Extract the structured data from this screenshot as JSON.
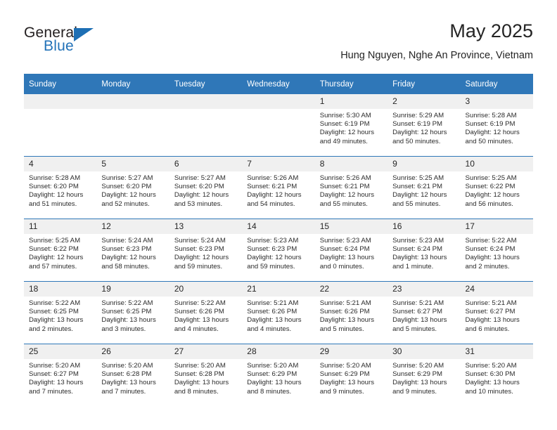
{
  "brand": {
    "name_top": "General",
    "name_bottom": "Blue",
    "triangle_color": "#1d6fb4",
    "text_color": "#231f20"
  },
  "header": {
    "title": "May 2025",
    "subtitle": "Hung Nguyen, Nghe An Province, Vietnam"
  },
  "theme": {
    "header_blue": "#2f77b8",
    "daynum_gray": "#f0f0f0",
    "text": "#262626"
  },
  "weekdays": [
    "Sunday",
    "Monday",
    "Tuesday",
    "Wednesday",
    "Thursday",
    "Friday",
    "Saturday"
  ],
  "weeks": [
    [
      {
        "day": "",
        "sunrise": "",
        "sunset": "",
        "daylight1": "",
        "daylight2": ""
      },
      {
        "day": "",
        "sunrise": "",
        "sunset": "",
        "daylight1": "",
        "daylight2": ""
      },
      {
        "day": "",
        "sunrise": "",
        "sunset": "",
        "daylight1": "",
        "daylight2": ""
      },
      {
        "day": "",
        "sunrise": "",
        "sunset": "",
        "daylight1": "",
        "daylight2": ""
      },
      {
        "day": "1",
        "sunrise": "Sunrise: 5:30 AM",
        "sunset": "Sunset: 6:19 PM",
        "daylight1": "Daylight: 12 hours",
        "daylight2": "and 49 minutes."
      },
      {
        "day": "2",
        "sunrise": "Sunrise: 5:29 AM",
        "sunset": "Sunset: 6:19 PM",
        "daylight1": "Daylight: 12 hours",
        "daylight2": "and 50 minutes."
      },
      {
        "day": "3",
        "sunrise": "Sunrise: 5:28 AM",
        "sunset": "Sunset: 6:19 PM",
        "daylight1": "Daylight: 12 hours",
        "daylight2": "and 50 minutes."
      }
    ],
    [
      {
        "day": "4",
        "sunrise": "Sunrise: 5:28 AM",
        "sunset": "Sunset: 6:20 PM",
        "daylight1": "Daylight: 12 hours",
        "daylight2": "and 51 minutes."
      },
      {
        "day": "5",
        "sunrise": "Sunrise: 5:27 AM",
        "sunset": "Sunset: 6:20 PM",
        "daylight1": "Daylight: 12 hours",
        "daylight2": "and 52 minutes."
      },
      {
        "day": "6",
        "sunrise": "Sunrise: 5:27 AM",
        "sunset": "Sunset: 6:20 PM",
        "daylight1": "Daylight: 12 hours",
        "daylight2": "and 53 minutes."
      },
      {
        "day": "7",
        "sunrise": "Sunrise: 5:26 AM",
        "sunset": "Sunset: 6:21 PM",
        "daylight1": "Daylight: 12 hours",
        "daylight2": "and 54 minutes."
      },
      {
        "day": "8",
        "sunrise": "Sunrise: 5:26 AM",
        "sunset": "Sunset: 6:21 PM",
        "daylight1": "Daylight: 12 hours",
        "daylight2": "and 55 minutes."
      },
      {
        "day": "9",
        "sunrise": "Sunrise: 5:25 AM",
        "sunset": "Sunset: 6:21 PM",
        "daylight1": "Daylight: 12 hours",
        "daylight2": "and 55 minutes."
      },
      {
        "day": "10",
        "sunrise": "Sunrise: 5:25 AM",
        "sunset": "Sunset: 6:22 PM",
        "daylight1": "Daylight: 12 hours",
        "daylight2": "and 56 minutes."
      }
    ],
    [
      {
        "day": "11",
        "sunrise": "Sunrise: 5:25 AM",
        "sunset": "Sunset: 6:22 PM",
        "daylight1": "Daylight: 12 hours",
        "daylight2": "and 57 minutes."
      },
      {
        "day": "12",
        "sunrise": "Sunrise: 5:24 AM",
        "sunset": "Sunset: 6:23 PM",
        "daylight1": "Daylight: 12 hours",
        "daylight2": "and 58 minutes."
      },
      {
        "day": "13",
        "sunrise": "Sunrise: 5:24 AM",
        "sunset": "Sunset: 6:23 PM",
        "daylight1": "Daylight: 12 hours",
        "daylight2": "and 59 minutes."
      },
      {
        "day": "14",
        "sunrise": "Sunrise: 5:23 AM",
        "sunset": "Sunset: 6:23 PM",
        "daylight1": "Daylight: 12 hours",
        "daylight2": "and 59 minutes."
      },
      {
        "day": "15",
        "sunrise": "Sunrise: 5:23 AM",
        "sunset": "Sunset: 6:24 PM",
        "daylight1": "Daylight: 13 hours",
        "daylight2": "and 0 minutes."
      },
      {
        "day": "16",
        "sunrise": "Sunrise: 5:23 AM",
        "sunset": "Sunset: 6:24 PM",
        "daylight1": "Daylight: 13 hours",
        "daylight2": "and 1 minute."
      },
      {
        "day": "17",
        "sunrise": "Sunrise: 5:22 AM",
        "sunset": "Sunset: 6:24 PM",
        "daylight1": "Daylight: 13 hours",
        "daylight2": "and 2 minutes."
      }
    ],
    [
      {
        "day": "18",
        "sunrise": "Sunrise: 5:22 AM",
        "sunset": "Sunset: 6:25 PM",
        "daylight1": "Daylight: 13 hours",
        "daylight2": "and 2 minutes."
      },
      {
        "day": "19",
        "sunrise": "Sunrise: 5:22 AM",
        "sunset": "Sunset: 6:25 PM",
        "daylight1": "Daylight: 13 hours",
        "daylight2": "and 3 minutes."
      },
      {
        "day": "20",
        "sunrise": "Sunrise: 5:22 AM",
        "sunset": "Sunset: 6:26 PM",
        "daylight1": "Daylight: 13 hours",
        "daylight2": "and 4 minutes."
      },
      {
        "day": "21",
        "sunrise": "Sunrise: 5:21 AM",
        "sunset": "Sunset: 6:26 PM",
        "daylight1": "Daylight: 13 hours",
        "daylight2": "and 4 minutes."
      },
      {
        "day": "22",
        "sunrise": "Sunrise: 5:21 AM",
        "sunset": "Sunset: 6:26 PM",
        "daylight1": "Daylight: 13 hours",
        "daylight2": "and 5 minutes."
      },
      {
        "day": "23",
        "sunrise": "Sunrise: 5:21 AM",
        "sunset": "Sunset: 6:27 PM",
        "daylight1": "Daylight: 13 hours",
        "daylight2": "and 5 minutes."
      },
      {
        "day": "24",
        "sunrise": "Sunrise: 5:21 AM",
        "sunset": "Sunset: 6:27 PM",
        "daylight1": "Daylight: 13 hours",
        "daylight2": "and 6 minutes."
      }
    ],
    [
      {
        "day": "25",
        "sunrise": "Sunrise: 5:20 AM",
        "sunset": "Sunset: 6:27 PM",
        "daylight1": "Daylight: 13 hours",
        "daylight2": "and 7 minutes."
      },
      {
        "day": "26",
        "sunrise": "Sunrise: 5:20 AM",
        "sunset": "Sunset: 6:28 PM",
        "daylight1": "Daylight: 13 hours",
        "daylight2": "and 7 minutes."
      },
      {
        "day": "27",
        "sunrise": "Sunrise: 5:20 AM",
        "sunset": "Sunset: 6:28 PM",
        "daylight1": "Daylight: 13 hours",
        "daylight2": "and 8 minutes."
      },
      {
        "day": "28",
        "sunrise": "Sunrise: 5:20 AM",
        "sunset": "Sunset: 6:29 PM",
        "daylight1": "Daylight: 13 hours",
        "daylight2": "and 8 minutes."
      },
      {
        "day": "29",
        "sunrise": "Sunrise: 5:20 AM",
        "sunset": "Sunset: 6:29 PM",
        "daylight1": "Daylight: 13 hours",
        "daylight2": "and 9 minutes."
      },
      {
        "day": "30",
        "sunrise": "Sunrise: 5:20 AM",
        "sunset": "Sunset: 6:29 PM",
        "daylight1": "Daylight: 13 hours",
        "daylight2": "and 9 minutes."
      },
      {
        "day": "31",
        "sunrise": "Sunrise: 5:20 AM",
        "sunset": "Sunset: 6:30 PM",
        "daylight1": "Daylight: 13 hours",
        "daylight2": "and 10 minutes."
      }
    ]
  ]
}
